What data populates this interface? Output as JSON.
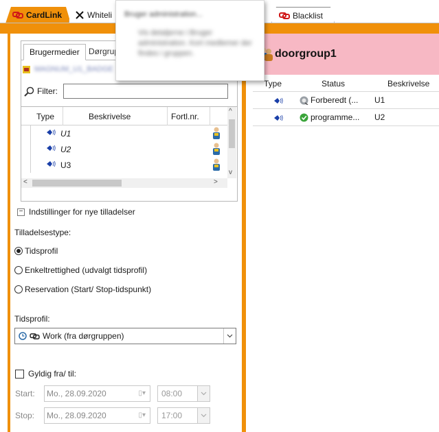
{
  "tabs": {
    "cardlink": "CardLink",
    "whitelist": "Whiteli",
    "blacklist": "Blacklist"
  },
  "tooltip": {
    "title": "Bruger administration...",
    "body": "Vis detaljerne i Bruger administration. Kort medlemer der findes i gruppen."
  },
  "left": {
    "subtabs": [
      "Brugermedier",
      "Dørgrup"
    ],
    "selected_item": "MAGNUM_U1_BADGE",
    "filter_label": "Filter:",
    "filter_value": "",
    "grid_headers": {
      "type": "Type",
      "description": "Beskrivelse",
      "dist_nr": "Fortl.nr."
    },
    "rows": [
      {
        "description": "U1",
        "italic": true
      },
      {
        "description": "U2",
        "italic": true
      },
      {
        "description": "U3",
        "italic": false
      }
    ],
    "settings_toggle": "Indstillinger for nye tilladelser",
    "permission_type_label": "Tilladelsestype:",
    "radio_options": [
      {
        "label": "Tidsprofil",
        "selected": true
      },
      {
        "label": "Enkeltrettighed (udvalgt tidsprofil)",
        "selected": false
      },
      {
        "label": "Reservation (Start/ Stop-tidspunkt)",
        "selected": false
      }
    ],
    "time_profile_label": "Tidsprofil:",
    "time_profile_value": "Work (fra dørgruppen)",
    "valid_checkbox_label": "Gyldig fra/ til:",
    "valid_checked": false,
    "start_label": "Start:",
    "start_date": "Mo., 28.09.2020",
    "start_time": "08:00",
    "stop_label": "Stop:",
    "stop_date": "Mo., 28.09.2020",
    "stop_time": "17:00"
  },
  "right": {
    "group_title": "doorgroup1",
    "headers": {
      "type": "Type",
      "status": "Status",
      "description": "Beskrivelse"
    },
    "rows": [
      {
        "status": "Forberedt (...",
        "status_icon": "pending-icon",
        "description": "U1"
      },
      {
        "status": "programme...",
        "status_icon": "check-icon",
        "description": "U2"
      }
    ]
  },
  "colors": {
    "accent_orange": "#f0900a",
    "group_header_pink": "#f7b8c4",
    "link_icon_red": "#d01818",
    "media_icon_blue": "#1a3fa8",
    "ok_green": "#3aa43a"
  }
}
